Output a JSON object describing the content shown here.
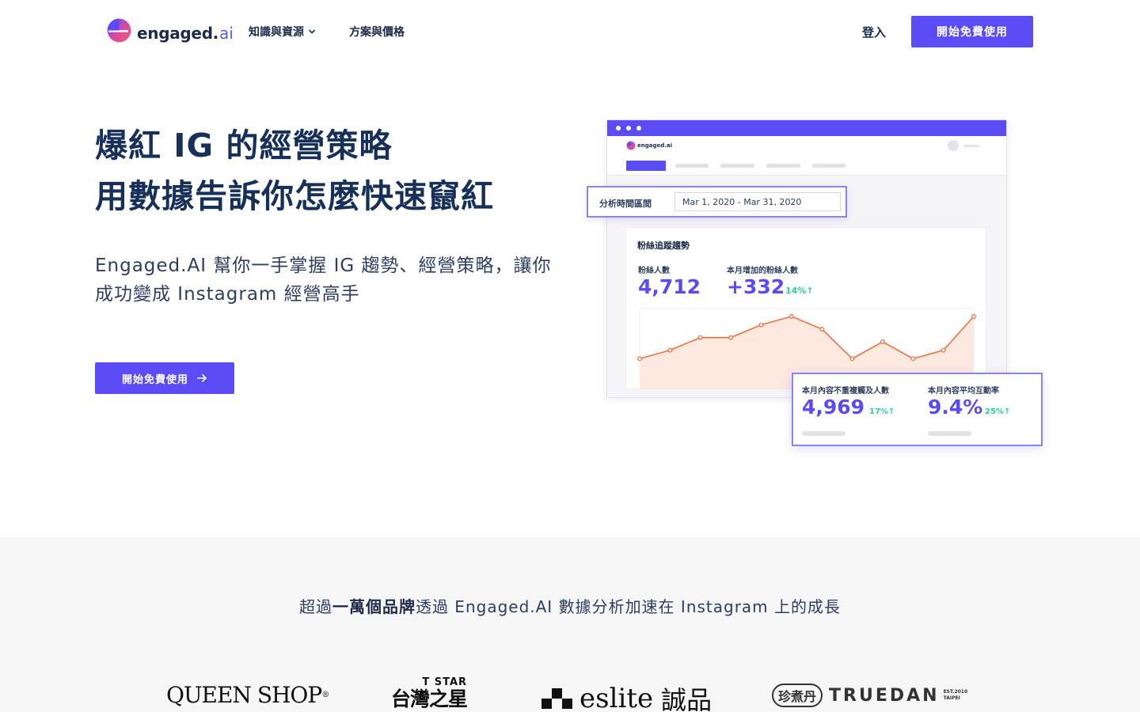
{
  "nav": {
    "logo_text": "engaged.",
    "logo_suffix": "ai",
    "links": [
      {
        "label": "知識與資源",
        "has_dropdown": true
      },
      {
        "label": "方案與價格",
        "has_dropdown": false
      }
    ],
    "login": "登入",
    "cta": "開始免費使用"
  },
  "hero": {
    "title_line1": "爆紅 IG 的經營策略",
    "title_line2": "用數據告訴你怎麼快速竄紅",
    "subtitle": "Engaged.AI 幫你一手掌握 IG 趨勢、經營策略，讓你成功變成 Instagram 經營高手",
    "cta": "開始免費使用"
  },
  "mockup": {
    "mini_logo": "engaged.ai",
    "date_label": "分析時間區間",
    "date_range": "Mar 1, 2020 - Mar 31, 2020",
    "chart_title": "粉絲追蹤趨勢",
    "followers_label": "粉絲人數",
    "followers_value": "4,712",
    "new_followers_label": "本月增加的粉絲人數",
    "new_followers_value": "+332",
    "new_followers_badge": "14%↑",
    "reach_label": "本月內容不重複觸及人數",
    "reach_value": "4,969",
    "reach_badge": "17%↑",
    "engagement_label": "本月內容平均互動率",
    "engagement_value": "9.4%",
    "engagement_badge": "25%↑",
    "trend_values": [
      2,
      4,
      7,
      7,
      10,
      12,
      9,
      2,
      6,
      2,
      4,
      12
    ]
  },
  "brands": {
    "text_before": "超過",
    "text_bold": "一萬個品牌",
    "text_after": "透過 Engaged.AI 數據分析加速在 Instagram 上的成長",
    "logos": {
      "queenshop": "QUEEN SHOP",
      "queenshop_mark": "®",
      "tstar_top": "T STAR",
      "tstar_bottom": "台灣之星",
      "eslite_en": "eslite",
      "eslite_zh": "誠品",
      "truedan_seal": "珍煮丹",
      "truedan_word": "TRUEDAN",
      "truedan_est": "EST.2010",
      "truedan_city": "TAIPEI"
    }
  },
  "colors": {
    "primary": "#5b4bf5",
    "navy": "#16305a",
    "positive": "#2ecf99",
    "trend_line": "#f07040"
  }
}
